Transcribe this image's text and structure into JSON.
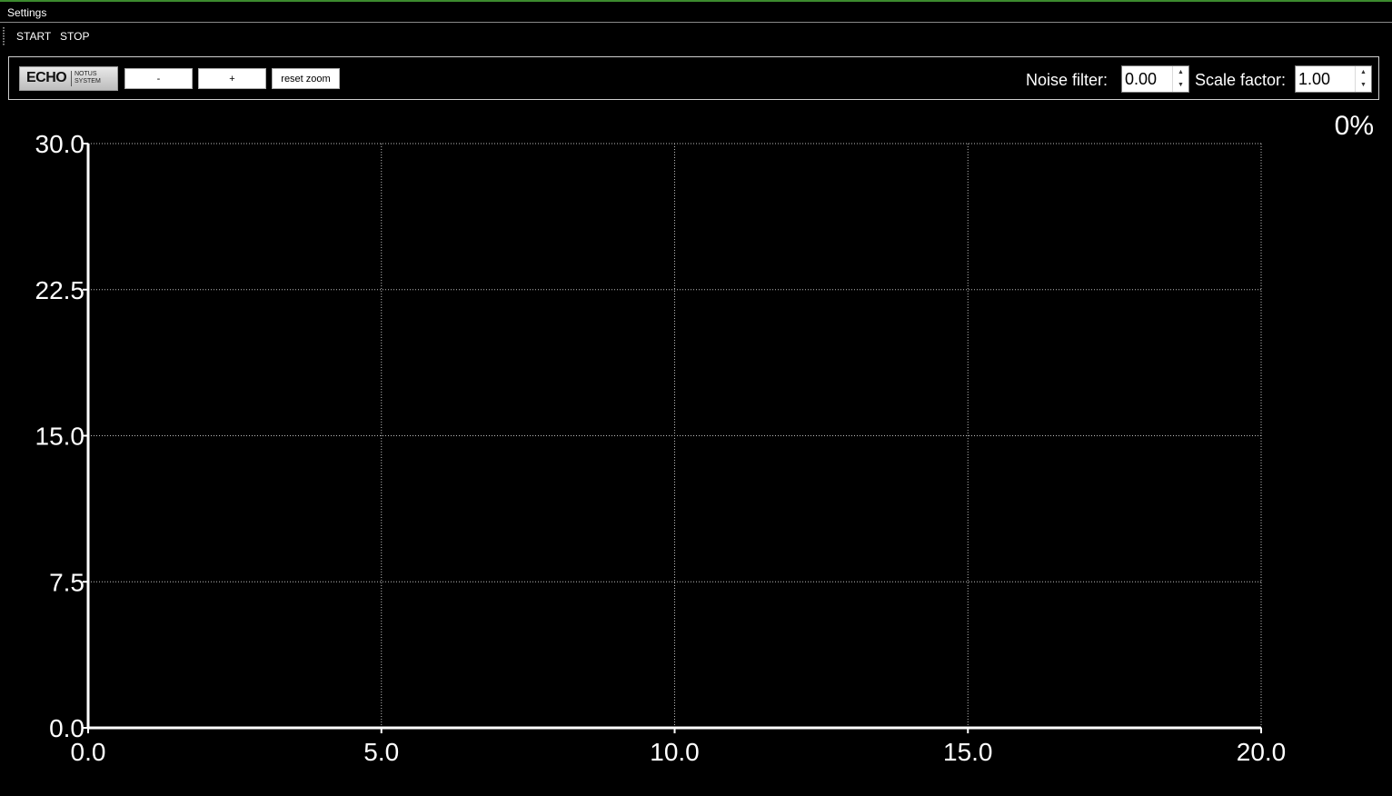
{
  "menubar": {
    "settings_label": "Settings"
  },
  "toolstrip": {
    "start_label": "START",
    "stop_label": "STOP"
  },
  "logo": {
    "main": "ECHO",
    "sub_line1": "NOTUS",
    "sub_line2": "SYSTEM"
  },
  "controls": {
    "zoom_out_label": "-",
    "zoom_in_label": "+",
    "reset_zoom_label": "reset zoom",
    "noise_filter_label": "Noise filter:",
    "noise_filter_value": "0.00",
    "scale_factor_label": "Scale factor:",
    "scale_factor_value": "1.00"
  },
  "status": {
    "percent": "0%"
  },
  "colors": {
    "accent_line": "#3c8a2e",
    "background": "#000000",
    "foreground": "#ffffff"
  },
  "chart_data": {
    "type": "line",
    "x_ticks": [
      "0.0",
      "5.0",
      "10.0",
      "15.0",
      "20.0"
    ],
    "y_ticks": [
      "0.0",
      "7.5",
      "15.0",
      "22.5",
      "30.0"
    ],
    "xlim": [
      0,
      20
    ],
    "ylim": [
      0,
      30
    ],
    "grid": true,
    "series": []
  }
}
